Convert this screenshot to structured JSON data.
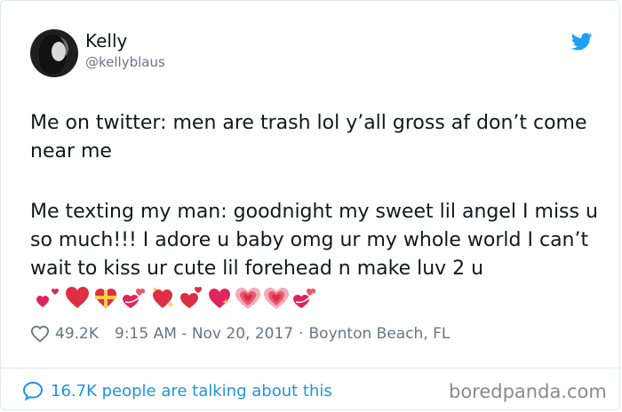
{
  "user": {
    "name": "Kelly",
    "handle": "@kellyblaus"
  },
  "tweet": {
    "paragraph1": "Me on twitter: men are trash lol y’all gross af don’t come near me",
    "paragraph2": "Me texting my man: goodnight my sweet lil angel I miss u so much!!! I adore u baby omg ur my whole world I can’t wait to kiss ur cute lil forehead n make luv 2 u",
    "emojis": [
      "heart-with-ribbon-icon",
      "red-heart-icon",
      "heart-gift-icon",
      "revolving-hearts-icon",
      "sparkling-heart-icon",
      "heart-with-arrow-icon",
      "sparkling-heart-icon",
      "growing-heart-icon",
      "growing-heart-icon",
      "revolving-hearts-icon"
    ]
  },
  "meta": {
    "likes": "49.2K",
    "time": "9:15 AM - Nov 20, 2017",
    "separator": "·",
    "location": "Boynton Beach, FL"
  },
  "footer": {
    "talking": "16.7K people are talking about this",
    "watermark": "boredpanda.com"
  },
  "colors": {
    "twitter_blue": "#1da1f2",
    "link_blue": "#1b95e0",
    "heart_red": "#e0245e",
    "muted": "#657786"
  }
}
